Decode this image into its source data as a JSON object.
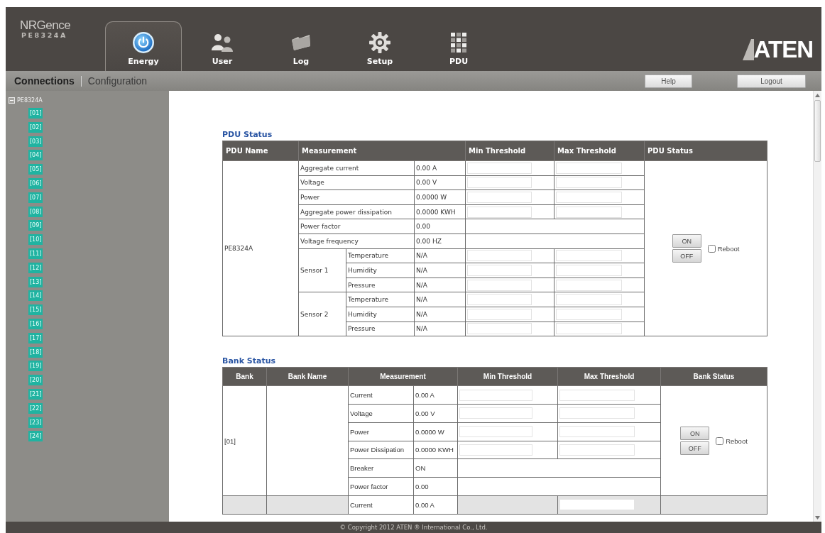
{
  "header": {
    "logo": {
      "brand": "NRGence",
      "model": "PE8324A"
    },
    "tabs": [
      {
        "label": "Energy",
        "selected": true
      },
      {
        "label": "User",
        "selected": false
      },
      {
        "label": "Log",
        "selected": false
      },
      {
        "label": "Setup",
        "selected": false
      },
      {
        "label": "PDU",
        "selected": false
      }
    ],
    "vendor_logo": "ATEN"
  },
  "subnav": {
    "links": [
      {
        "label": "Connections",
        "selected": true
      },
      {
        "label": "Configuration",
        "selected": false
      }
    ],
    "buttons": [
      "Help",
      "Logout"
    ]
  },
  "sidebar": {
    "tree": [
      {
        "label": "PE8324A",
        "expanded": true,
        "children": [
          {
            "label": "[01]"
          },
          {
            "label": "[02]"
          },
          {
            "label": "[03]"
          },
          {
            "label": "[04]"
          },
          {
            "label": "[05]"
          },
          {
            "label": "[06]"
          },
          {
            "label": "[07]"
          },
          {
            "label": "[08]"
          },
          {
            "label": "[09]"
          },
          {
            "label": "[10]"
          },
          {
            "label": "[11]"
          },
          {
            "label": "[12]"
          },
          {
            "label": "[13]"
          },
          {
            "label": "[14]"
          },
          {
            "label": "[15]"
          },
          {
            "label": "[16]"
          },
          {
            "label": "[17]"
          },
          {
            "label": "[18]"
          },
          {
            "label": "[19]"
          },
          {
            "label": "[20]"
          },
          {
            "label": "[21]"
          },
          {
            "label": "[22]"
          },
          {
            "label": "[23]"
          },
          {
            "label": "[24]"
          }
        ]
      }
    ]
  },
  "pdu_status": {
    "title": "PDU Status",
    "columns": [
      "PDU Name",
      "Measurement",
      "Min Threshold",
      "Max Threshold",
      "PDU Status"
    ],
    "pdu": {
      "name": "PE8324A",
      "measurements": [
        {
          "label": "Aggregate current",
          "value": "0.00 A",
          "min_field": true,
          "max_field": true
        },
        {
          "label": "Voltage",
          "value": "0.00 V",
          "min_field": true,
          "max_field": true
        },
        {
          "label": "Power",
          "value": "0.0000 W",
          "min_field": true,
          "max_field": true
        },
        {
          "label": "Aggregate power dissipation",
          "value": "0.0000 KWH",
          "min_field": true,
          "max_field": true
        },
        {
          "label": "Power factor",
          "value": "0.00",
          "min_field": false,
          "max_field": false
        },
        {
          "label": "Voltage frequency",
          "value": "0.00 HZ",
          "min_field": false,
          "max_field": false
        }
      ],
      "sensors": [
        {
          "label": "Sensor 1",
          "readings": [
            {
              "label": "Temperature",
              "value": "N/A",
              "min_field": true,
              "max_field": true
            },
            {
              "label": "Humidity",
              "value": "N/A",
              "min_field": true,
              "max_field": true
            },
            {
              "label": "Pressure",
              "value": "N/A",
              "min_field": true,
              "max_field": true
            }
          ]
        },
        {
          "label": "Sensor 2",
          "readings": [
            {
              "label": "Temperature",
              "value": "N/A",
              "min_field": true,
              "max_field": true
            },
            {
              "label": "Humidity",
              "value": "N/A",
              "min_field": true,
              "max_field": true
            },
            {
              "label": "Pressure",
              "value": "N/A",
              "min_field": true,
              "max_field": true
            }
          ]
        }
      ],
      "switch_buttons": [
        "ON",
        "OFF"
      ],
      "reboot": {
        "label": "Reboot",
        "checked": false
      }
    }
  },
  "bank_status": {
    "title": "Bank Status",
    "columns": [
      "Bank",
      "Bank Name",
      "Measurement",
      "Min Threshold",
      "Max Threshold",
      "Bank Status"
    ],
    "banks": [
      {
        "bank": "[01]",
        "measurements": [
          {
            "label": "Current",
            "value": "0.00 A",
            "min_field": true,
            "max_field": true
          },
          {
            "label": "Voltage",
            "value": "0.00 V",
            "min_field": true,
            "max_field": true
          },
          {
            "label": "Power",
            "value": "0.0000 W",
            "min_field": true,
            "max_field": true
          },
          {
            "label": "Power Dissipation",
            "value": "0.0000 KWH",
            "min_field": true,
            "max_field": true
          },
          {
            "label": "Breaker",
            "value": "ON",
            "min_field": false,
            "max_field": false
          },
          {
            "label": "Power factor",
            "value": "0.00",
            "min_field": false,
            "max_field": false
          }
        ],
        "switch_buttons": [
          "ON",
          "OFF"
        ],
        "reboot": {
          "label": "Reboot",
          "checked": false
        }
      },
      {
        "measurements": [
          {
            "label": "Current",
            "value": "0.00 A",
            "min_field": false,
            "max_field": true
          }
        ]
      }
    ]
  },
  "footer": {
    "copyright": "© Copyright 2012 ATEN ® International Co., Ltd."
  }
}
